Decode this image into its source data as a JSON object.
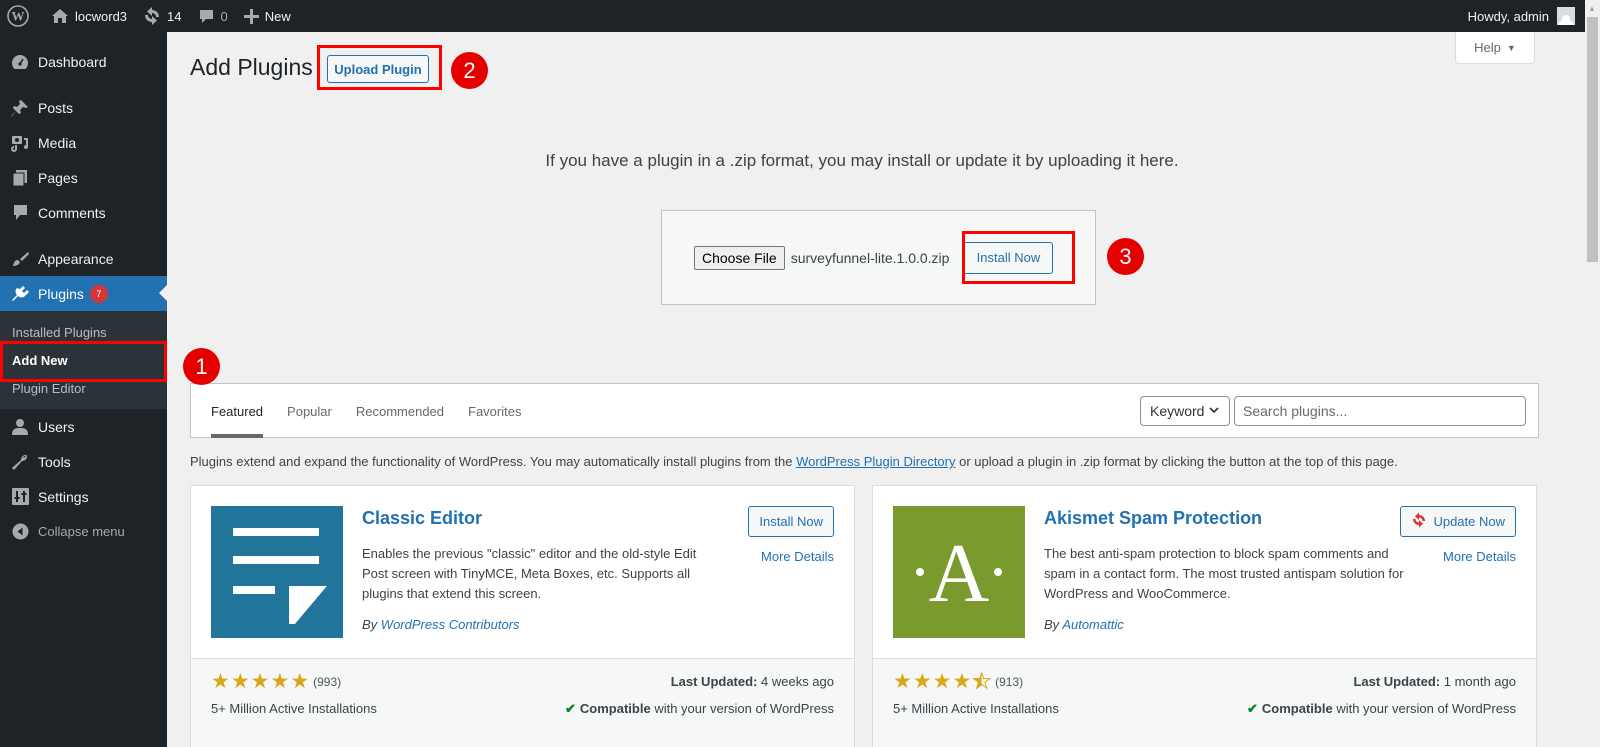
{
  "adminbar": {
    "site_name": "locword3",
    "updates_count": "14",
    "comments_count": "0",
    "new_label": "New",
    "greeting": "Howdy, admin"
  },
  "sidebar": {
    "items": [
      {
        "label": "Dashboard",
        "icon": "dashboard-icon"
      },
      {
        "label": "Posts",
        "icon": "pin-icon"
      },
      {
        "label": "Media",
        "icon": "media-icon"
      },
      {
        "label": "Pages",
        "icon": "pages-icon"
      },
      {
        "label": "Comments",
        "icon": "comment-icon"
      },
      {
        "label": "Appearance",
        "icon": "paintbrush-icon"
      },
      {
        "label": "Plugins",
        "icon": "plugin-icon",
        "badge": "7",
        "active": true
      },
      {
        "label": "Users",
        "icon": "user-icon"
      },
      {
        "label": "Tools",
        "icon": "wrench-icon"
      },
      {
        "label": "Settings",
        "icon": "settings-icon"
      }
    ],
    "submenu": [
      {
        "label": "Installed Plugins"
      },
      {
        "label": "Add New",
        "current": true
      },
      {
        "label": "Plugin Editor"
      }
    ],
    "collapse_label": "Collapse menu"
  },
  "annotations": {
    "step1": "1",
    "step2": "2",
    "step3": "3",
    "highlight_color": "#ff0000"
  },
  "main": {
    "title": "Add Plugins",
    "upload_button": "Upload Plugin",
    "help_label": "Help",
    "upload_text": "If you have a plugin in a .zip format, you may install or update it by uploading it here.",
    "choose_file_label": "Choose File",
    "file_name": "surveyfunnel-lite.1.0.0.zip",
    "install_now_label": "Install Now",
    "tabs": [
      {
        "label": "Featured",
        "current": true
      },
      {
        "label": "Popular"
      },
      {
        "label": "Recommended"
      },
      {
        "label": "Favorites"
      }
    ],
    "search_type": "Keyword",
    "search_placeholder": "Search plugins...",
    "intro_before": "Plugins extend and expand the functionality of WordPress. You may automatically install plugins from the ",
    "intro_link": "WordPress Plugin Directory",
    "intro_after": " or upload a plugin in .zip format by clicking the button at the top of this page."
  },
  "plugins": [
    {
      "name": "Classic Editor",
      "description": "Enables the previous \"classic\" editor and the old-style Edit Post screen with TinyMCE, Meta Boxes, etc. Supports all plugins that extend this screen.",
      "author_prefix": "By ",
      "author": "WordPress Contributors",
      "action": "Install Now",
      "more_details": "More Details",
      "rating": 5,
      "rating_count": "(993)",
      "installs": "5+ Million Active Installations",
      "last_updated_label": "Last Updated:",
      "last_updated": " 4 weeks ago",
      "compatible_label": "Compatible",
      "compatible_text": " with your version of WordPress",
      "thumb_color": "#21759b"
    },
    {
      "name": "Akismet Spam Protection",
      "description": "The best anti-spam protection to block spam comments and spam in a contact form. The most trusted antispam solution for WordPress and WooCommerce.",
      "author_prefix": "By ",
      "author": "Automattic",
      "action": "Update Now",
      "more_details": "More Details",
      "rating": 4.5,
      "rating_count": "(913)",
      "installs": "5+ Million Active Installations",
      "last_updated_label": "Last Updated:",
      "last_updated": " 1 month ago",
      "compatible_label": "Compatible",
      "compatible_text": " with your version of WordPress",
      "thumb_color": "#7a9a2e",
      "thumb_glyph": "·A·"
    }
  ]
}
